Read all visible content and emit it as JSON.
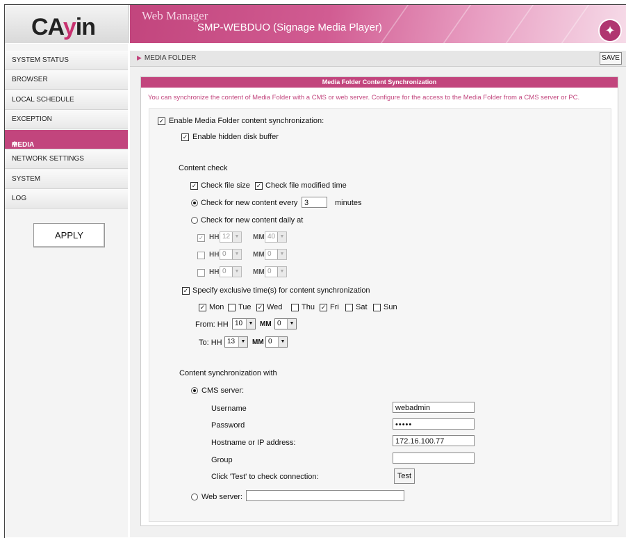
{
  "brand": {
    "logo_a": "CA",
    "logo_y": "y",
    "logo_b": "in",
    "accent": "#c2457d"
  },
  "header": {
    "title": "Web Manager",
    "subtitle": "SMP-WEBDUO (Signage Media Player)",
    "icon": "magic-wand-icon"
  },
  "sidebar": {
    "items": [
      {
        "label": "SYSTEM STATUS"
      },
      {
        "label": "BROWSER"
      },
      {
        "label": "LOCAL SCHEDULE"
      },
      {
        "label": "EXCEPTION"
      },
      {
        "label": "MEDIA FOLDER",
        "active": true
      },
      {
        "label": "NETWORK SETTINGS"
      },
      {
        "label": "SYSTEM"
      },
      {
        "label": "LOG"
      }
    ],
    "apply_label": "APPLY"
  },
  "topbar": {
    "breadcrumb": "MEDIA FOLDER",
    "save_label": "SAVE"
  },
  "panel": {
    "title": "Media Folder Content Synchronization",
    "description": "You can synchronize the content of Media Folder with a CMS or web server. Configure for the access to the Media Folder from a CMS server or PC.",
    "enable_sync": {
      "label": "Enable Media Folder content synchronization:",
      "checked": true
    },
    "hidden_buffer": {
      "label": "Enable hidden disk buffer",
      "checked": true
    },
    "content_check": {
      "heading": "Content check",
      "file_size": {
        "label": "Check file size",
        "checked": true
      },
      "modified_time": {
        "label": "Check file modified time",
        "checked": true
      },
      "every": {
        "label": "Check for new content every",
        "value": "3",
        "unit": "minutes",
        "selected": true
      },
      "daily": {
        "label": "Check for new content daily at",
        "selected": false
      },
      "times": [
        {
          "checked": true,
          "hh_label": "HH",
          "hh": "12",
          "mm_label": "MM",
          "mm": "40"
        },
        {
          "checked": false,
          "hh_label": "HH",
          "hh": "0",
          "mm_label": "MM",
          "mm": "0"
        },
        {
          "checked": false,
          "hh_label": "HH",
          "hh": "0",
          "mm_label": "MM",
          "mm": "0"
        }
      ]
    },
    "exclusive": {
      "label": "Specify exclusive time(s) for content synchronization",
      "checked": true,
      "days": [
        {
          "label": "Mon",
          "checked": true
        },
        {
          "label": "Tue",
          "checked": false
        },
        {
          "label": "Wed",
          "checked": true
        },
        {
          "label": "Thu",
          "checked": false
        },
        {
          "label": "Fri",
          "checked": true
        },
        {
          "label": "Sat",
          "checked": false
        },
        {
          "label": "Sun",
          "checked": false
        }
      ],
      "from": {
        "label": "From: HH",
        "hh": "10",
        "mm_label": "MM",
        "mm": "0"
      },
      "to": {
        "label": "To: HH",
        "hh": "13",
        "mm_label": "MM",
        "mm": "0"
      }
    },
    "sync_with": {
      "heading": "Content synchronization with",
      "cms": {
        "label": "CMS server:",
        "selected": true
      },
      "username": {
        "label": "Username",
        "value": "webadmin"
      },
      "password": {
        "label": "Password",
        "value": "•••••"
      },
      "hostname": {
        "label": "Hostname or IP address:",
        "value": "172.16.100.77"
      },
      "group": {
        "label": "Group",
        "value": ""
      },
      "test": {
        "label": "Click 'Test' to check connection:",
        "button": "Test"
      },
      "web": {
        "label": "Web server:",
        "selected": false,
        "value": ""
      }
    }
  }
}
